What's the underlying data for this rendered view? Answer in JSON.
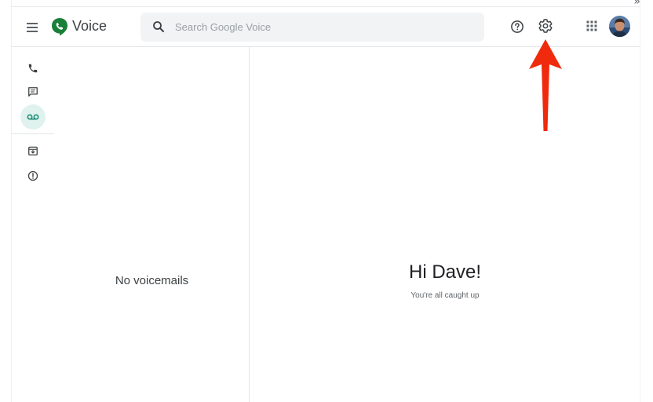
{
  "header": {
    "app_name": "Voice",
    "search_placeholder": "Search Google Voice"
  },
  "icons": {
    "menu": "menu-icon",
    "logo": "google-voice-logo",
    "search": "search-icon",
    "help": "help-circle-icon",
    "settings": "gear-icon",
    "apps": "apps-grid-icon",
    "avatar": "user-avatar"
  },
  "sidebar": {
    "items": [
      {
        "name": "Calls",
        "icon": "phone-icon",
        "active": false
      },
      {
        "name": "Messages",
        "icon": "message-icon",
        "active": false
      },
      {
        "name": "Voicemail",
        "icon": "voicemail-icon",
        "active": true
      },
      {
        "name": "Archive",
        "icon": "archive-icon",
        "active": false
      },
      {
        "name": "Spam",
        "icon": "spam-icon",
        "active": false
      }
    ]
  },
  "list_pane": {
    "empty_text": "No voicemails"
  },
  "detail_pane": {
    "greeting": "Hi Dave!",
    "subtext": "You're all caught up"
  },
  "colors": {
    "brand_green": "#188038",
    "active_rail_bg": "#e0f2ee",
    "active_rail_icon": "#1e8e76",
    "annotation_arrow": "#f02a0c"
  }
}
